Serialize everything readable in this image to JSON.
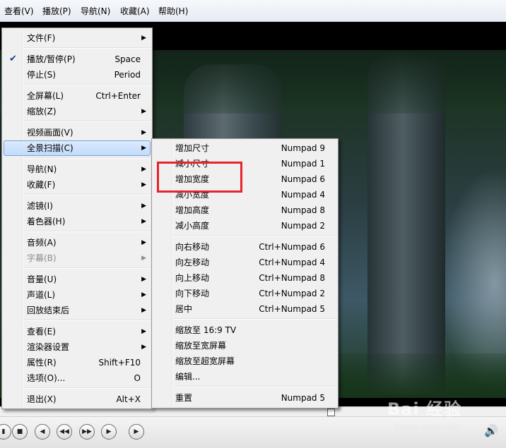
{
  "menubar": {
    "items": [
      {
        "label": "查看(V)"
      },
      {
        "label": "播放(P)"
      },
      {
        "label": "导航(N)"
      },
      {
        "label": "收藏(A)"
      },
      {
        "label": "帮助(H)"
      }
    ]
  },
  "context_menu": {
    "items": [
      {
        "label": "文件(F)",
        "has_submenu": true
      },
      {
        "label": "播放/暂停(P)",
        "shortcut": "Space",
        "checked": true
      },
      {
        "label": "停止(S)",
        "shortcut": "Period"
      },
      {
        "label": "全屏幕(L)",
        "shortcut": "Ctrl+Enter"
      },
      {
        "label": "缩放(Z)",
        "has_submenu": true
      },
      {
        "label": "视频画面(V)",
        "has_submenu": true
      },
      {
        "label": "全景扫描(C)",
        "has_submenu": true,
        "highlighted": true
      },
      {
        "label": "导航(N)",
        "has_submenu": true
      },
      {
        "label": "收藏(F)",
        "has_submenu": true
      },
      {
        "label": "滤镜(I)",
        "has_submenu": true
      },
      {
        "label": "着色器(H)",
        "has_submenu": true
      },
      {
        "label": "音频(A)",
        "has_submenu": true
      },
      {
        "label": "字幕(B)",
        "has_submenu": true,
        "disabled": true
      },
      {
        "label": "音量(U)",
        "has_submenu": true
      },
      {
        "label": "声道(L)",
        "has_submenu": true
      },
      {
        "label": "回放结束后",
        "has_submenu": true
      },
      {
        "label": "查看(E)",
        "has_submenu": true
      },
      {
        "label": "渲染器设置",
        "has_submenu": true
      },
      {
        "label": "属性(R)",
        "shortcut": "Shift+F10"
      },
      {
        "label": "选项(O)...",
        "shortcut": "O"
      },
      {
        "label": "退出(X)",
        "shortcut": "Alt+X"
      }
    ]
  },
  "submenu": {
    "items": [
      {
        "label": "增加尺寸",
        "shortcut": "Numpad 9"
      },
      {
        "label": "减小尺寸",
        "shortcut": "Numpad 1"
      },
      {
        "label": "增加宽度",
        "shortcut": "Numpad 6"
      },
      {
        "label": "减小宽度",
        "shortcut": "Numpad 4"
      },
      {
        "label": "增加高度",
        "shortcut": "Numpad 8"
      },
      {
        "label": "减小高度",
        "shortcut": "Numpad 2"
      },
      {
        "label": "向右移动",
        "shortcut": "Ctrl+Numpad 6"
      },
      {
        "label": "向左移动",
        "shortcut": "Ctrl+Numpad 4"
      },
      {
        "label": "向上移动",
        "shortcut": "Ctrl+Numpad 8"
      },
      {
        "label": "向下移动",
        "shortcut": "Ctrl+Numpad 2"
      },
      {
        "label": "居中",
        "shortcut": "Ctrl+Numpad 5"
      },
      {
        "label": "缩放至 16:9 TV"
      },
      {
        "label": "缩放至宽屏幕"
      },
      {
        "label": "缩放至超宽屏幕"
      },
      {
        "label": "编辑..."
      },
      {
        "label": "重置",
        "shortcut": "Numpad 5"
      }
    ]
  },
  "controls": {
    "buttons": [
      {
        "icon": "play-pause-icon"
      },
      {
        "icon": "stop-icon"
      },
      {
        "icon": "skip-previous-icon"
      },
      {
        "icon": "rewind-icon"
      },
      {
        "icon": "fast-forward-icon"
      },
      {
        "icon": "skip-next-icon"
      },
      {
        "icon": "frame-step-icon"
      }
    ],
    "volume_icon": "speaker-icon"
  },
  "watermark": {
    "brand": "Bai  经验",
    "url": "jingyan.baidu.com"
  },
  "colors": {
    "highlight_border": "#7da2ce",
    "annotation_box": "#e8232b"
  }
}
